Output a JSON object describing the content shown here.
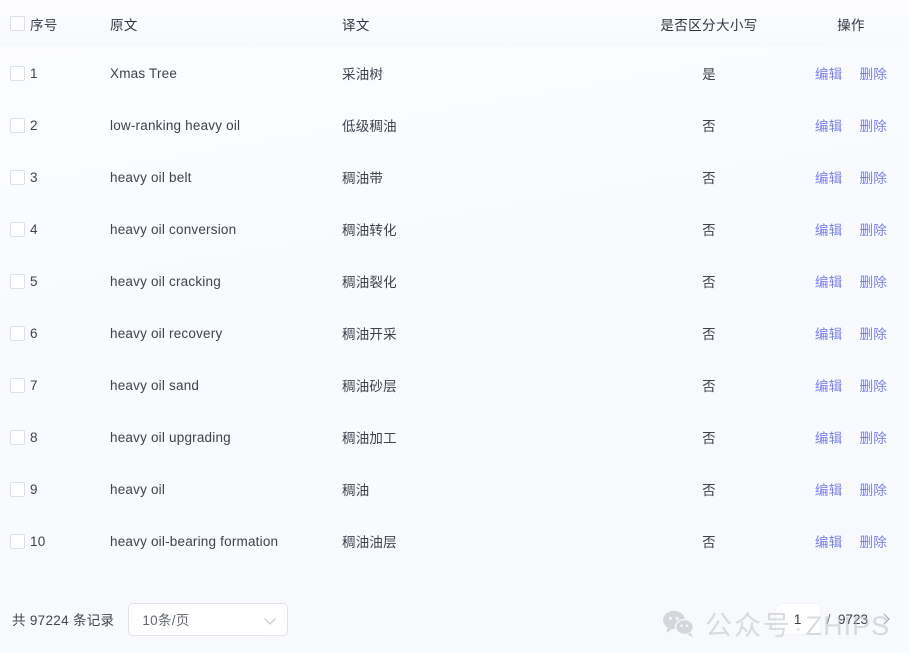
{
  "table": {
    "columns": {
      "select_all": "",
      "index": "序号",
      "source": "原文",
      "target": "译文",
      "case_sensitive": "是否区分大小写",
      "actions": "操作"
    },
    "action_labels": {
      "edit": "编辑",
      "delete": "删除"
    },
    "rows": [
      {
        "index": "1",
        "source": "Xmas Tree",
        "target": "采油树",
        "case_sensitive": "是"
      },
      {
        "index": "2",
        "source": "low-ranking heavy oil",
        "target": "低级稠油",
        "case_sensitive": "否"
      },
      {
        "index": "3",
        "source": "heavy oil belt",
        "target": "稠油带",
        "case_sensitive": "否"
      },
      {
        "index": "4",
        "source": "heavy oil conversion",
        "target": "稠油转化",
        "case_sensitive": "否"
      },
      {
        "index": "5",
        "source": "heavy oil cracking",
        "target": "稠油裂化",
        "case_sensitive": "否"
      },
      {
        "index": "6",
        "source": "heavy oil recovery",
        "target": "稠油开采",
        "case_sensitive": "否"
      },
      {
        "index": "7",
        "source": "heavy oil sand",
        "target": "稠油砂层",
        "case_sensitive": "否"
      },
      {
        "index": "8",
        "source": "heavy oil upgrading",
        "target": "稠油加工",
        "case_sensitive": "否"
      },
      {
        "index": "9",
        "source": "heavy oil",
        "target": "稠油",
        "case_sensitive": "否"
      },
      {
        "index": "10",
        "source": "heavy oil-bearing formation",
        "target": "稠油油层",
        "case_sensitive": "否"
      }
    ]
  },
  "footer": {
    "total_text": "共 97224 条记录",
    "total_count": "97224",
    "page_size": {
      "value": "10条/页",
      "icon": "chevron-down-icon"
    },
    "pagination": {
      "current_page": "1",
      "separator": "/",
      "total_pages": "9723",
      "next_icon": "chevron-right-icon"
    }
  },
  "watermark": {
    "icon": "wechat-icon",
    "label_zh": "公众号",
    "separator": "·",
    "label_en": "ZHIPS"
  },
  "colors": {
    "link": "#7b80e6",
    "background": "#fafbfe",
    "header_text": "#303440",
    "body_text": "#3e424d",
    "border": "#e2e4ea",
    "watermark": "#b9bcc3"
  }
}
